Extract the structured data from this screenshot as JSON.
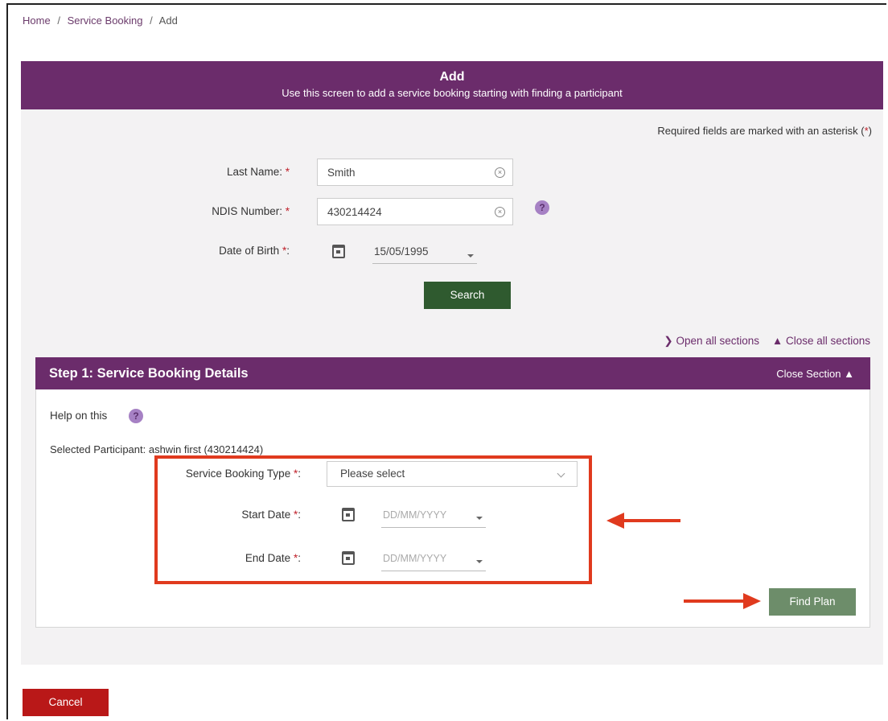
{
  "breadcrumb": {
    "home": "Home",
    "sep": "/",
    "section": "Service Booking",
    "current": "Add"
  },
  "header": {
    "title": "Add",
    "subtitle": "Use this screen to add a service booking starting with finding a participant"
  },
  "required_note": {
    "prefix": "Required fields are marked with an asterisk (",
    "asterisk": "*",
    "suffix": ")"
  },
  "search_form": {
    "last_name": {
      "label": "Last Name:",
      "asterisk": "*",
      "value": "Smith"
    },
    "ndis_number": {
      "label": "NDIS Number:",
      "asterisk": "*",
      "value": "430214424"
    },
    "date_of_birth": {
      "label": "Date of Birth",
      "asterisk": "*",
      "colon": ":",
      "value": "15/05/1995"
    },
    "search_button": "Search"
  },
  "sections": {
    "open_all": "Open all sections",
    "close_all": "Close all sections"
  },
  "step1": {
    "title": "Step 1: Service Booking Details",
    "close_section": "Close Section",
    "help_label": "Help on this",
    "selected_participant": "Selected Participant: ashwin first (430214424)",
    "service_booking_type": {
      "label": "Service Booking Type",
      "asterisk": "*",
      "colon": ":",
      "value": "Please select"
    },
    "start_date": {
      "label": "Start Date",
      "asterisk": "*",
      "colon": ":",
      "placeholder": "DD/MM/YYYY"
    },
    "end_date": {
      "label": "End Date",
      "asterisk": "*",
      "colon": ":",
      "placeholder": "DD/MM/YYYY"
    },
    "find_plan_button": "Find Plan"
  },
  "help_glyph": "?",
  "clear_glyph": "×",
  "cancel_button": "Cancel",
  "icons": [
    "calendar-icon",
    "clear-icon",
    "help-icon",
    "chevron-down-icon",
    "chevron-up-icon"
  ],
  "colors": {
    "brand_purple": "#6b2c6b",
    "search_green": "#2f5a2f",
    "find_plan_green": "#6d8d6a",
    "cancel_red": "#b91818",
    "annotation_red": "#e03a1e"
  }
}
